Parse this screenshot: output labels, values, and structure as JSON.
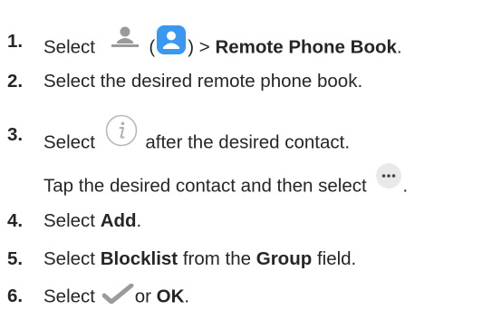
{
  "steps": [
    {
      "number": "1.",
      "prefix": "Select",
      "paren_open": "(",
      "paren_close": ")",
      "sep": ">",
      "bold": "Remote Phone Book",
      "end": "."
    },
    {
      "number": "2.",
      "text": "Select the desired remote phone book."
    },
    {
      "number": "3.",
      "prefix": "Select",
      "suffix": "after the desired contact."
    },
    {
      "alt_text": "Tap the desired contact and then select",
      "alt_end": "."
    },
    {
      "number": "4.",
      "prefix": "Select",
      "bold": "Add",
      "end": "."
    },
    {
      "number": "5.",
      "prefix": "Select",
      "bold1": "Blocklist",
      "middle": "from the",
      "bold2": "Group",
      "suffix": "field."
    },
    {
      "number": "6.",
      "prefix": "Select",
      "or_word": "or",
      "bold": "OK",
      "end": "."
    }
  ],
  "icons": {
    "step1_a": "contact-gray-icon",
    "step1_b": "contact-blue-icon",
    "step3": "info-icon",
    "step3_alt": "more-icon",
    "step6": "checkmark-icon"
  },
  "colors": {
    "text": "#262626",
    "blue": "#3a97f2",
    "gray_icon": "#9a9a9a",
    "info_outline": "#b8b8b8",
    "check": "#9b9b9b"
  }
}
